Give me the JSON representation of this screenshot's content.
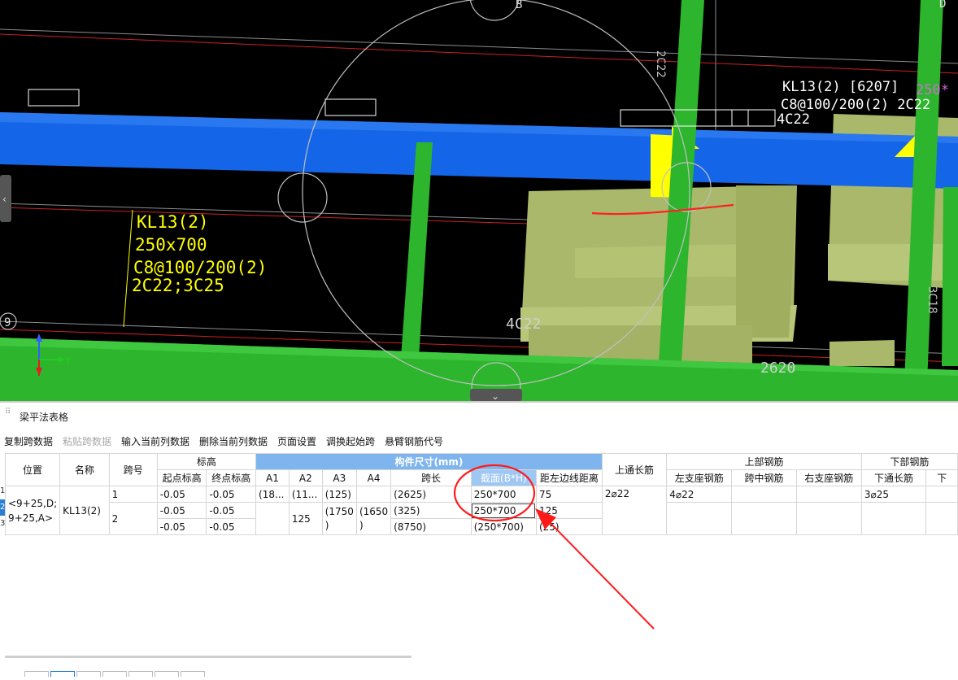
{
  "viewport": {
    "axis_labels": {
      "b": "B",
      "d": "D",
      "grid9": "9",
      "y": "Y"
    },
    "cad_text_left": [
      "KL13(2)",
      "250x700",
      "C8@100/200(2)",
      "2C22;3C25"
    ],
    "cad_text_right": {
      "line1": "KL13(2) [6207]",
      "line1_size": "250*",
      "line2": "C8@100/200(2) 2C22",
      "line3": "4C22"
    },
    "cad_misc": {
      "bottom_a": "4C22",
      "bottom_b": "2620",
      "vertical_a": "2C22",
      "vertical_b": "3C18"
    },
    "colors": {
      "beam_blue": "#1565e8",
      "column_green": "#2db52d",
      "slab_olive": "#a9b86a",
      "support_yellow": "#ffff00",
      "annotation_red": "#ff2020"
    }
  },
  "panel": {
    "title": "梁平法表格",
    "toolbar": [
      "复制跨数据",
      "粘贴跨数据",
      "输入当前列数据",
      "删除当前列数据",
      "页面设置",
      "调换起始跨",
      "悬臂钢筋代号"
    ],
    "toolbar_disabled": "粘贴跨数据"
  },
  "table": {
    "headers_top": {
      "position": "位置",
      "name": "名称",
      "span": "跨号",
      "elevation": "标高",
      "dimensions": "构件尺寸(mm)",
      "top_through": "上通长筋",
      "top_rebar": "上部钢筋",
      "bottom_rebar": "下部钢筋"
    },
    "headers_sub": {
      "start_elev": "起点标高",
      "end_elev": "终点标高",
      "a1": "A1",
      "a2": "A2",
      "a3": "A3",
      "a4": "A4",
      "span_len": "跨长",
      "section": "截面(B*H)",
      "left_dist": "距左边线距离",
      "left_support": "左支座钢筋",
      "mid_span": "跨中钢筋",
      "right_support": "右支座钢筋",
      "bottom_through": "下通长筋",
      "bottom_more": "下"
    },
    "row_numbers": [
      "1",
      "2",
      "3"
    ],
    "position_value": "<9+25,D;\n9+25,A>",
    "name_value": "KL13(2)",
    "rows": [
      {
        "span": "1",
        "start": "-0.05",
        "end": "-0.05",
        "a1": "(18...",
        "a2": "(11...",
        "a3": "(125)",
        "a4": "",
        "len": "(2625)",
        "section": "250*700",
        "dist": "75",
        "top_through": "2⌀22",
        "left_support": "4⌀22",
        "mid": "",
        "right_support": "",
        "bottom_through": "3⌀25"
      },
      {
        "span": "2",
        "start": "-0.05",
        "end": "-0.05",
        "a1": "",
        "a2": "125",
        "a3": "(1750\n)",
        "a4": "(1650\n)",
        "len": "(325)",
        "section": "250*700",
        "dist": "125",
        "top_through": "",
        "left_support": "",
        "mid": "",
        "right_support": "",
        "bottom_through": ""
      },
      {
        "span": "",
        "start": "-0.05",
        "end": "-0.05",
        "a1": "",
        "a2": "",
        "a3": "",
        "a4": "",
        "len": "(8750)",
        "section": "(250*700)",
        "dist": "(25)",
        "top_through": "",
        "left_support": "",
        "mid": "",
        "right_support": "",
        "bottom_through": ""
      }
    ]
  }
}
